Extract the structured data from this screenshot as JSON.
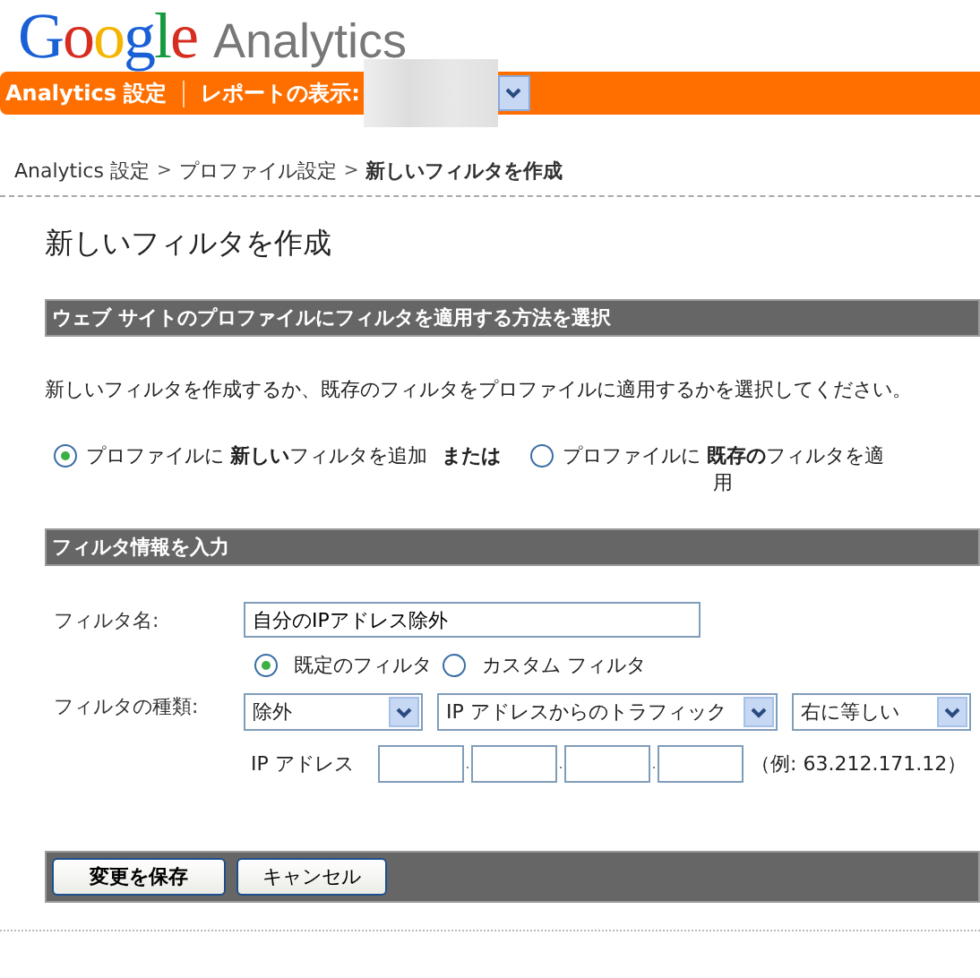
{
  "logo": {
    "brand": "Google",
    "product": "Analytics"
  },
  "nav": {
    "settings_link": "Analytics 設定",
    "report_label": "レポートの表示:"
  },
  "breadcrumb": {
    "items": [
      {
        "label": "Analytics 設定",
        "current": false
      },
      {
        "label": "プロファイル設定",
        "current": false
      },
      {
        "label": "新しいフィルタを作成",
        "current": true
      }
    ],
    "separators": [
      ">",
      ">"
    ]
  },
  "page_title": "新しいフィルタを作成",
  "method_section": {
    "header": "ウェブ サイトのプロファイルにフィルタを適用する方法を選択",
    "description": "新しいフィルタを作成するか、既存のフィルタをプロファイルに適用するかを選択してください。",
    "options": [
      {
        "label": "プロファイルに **新しい**フィルタを追加",
        "selected": true
      },
      {
        "label": "プロファイルに **既存の**フィルタを適用",
        "selected": false
      }
    ],
    "conjunction": "または"
  },
  "info_section": {
    "header": "フィルタ情報を入力",
    "name_label": "フィルタ名:",
    "name_value": "自分のIPアドレス除外",
    "type_label": "フィルタの種類:",
    "type_options": [
      {
        "label": "既定のフィルタ",
        "selected": true
      },
      {
        "label": "カスタム フィルタ",
        "selected": false
      }
    ],
    "dropdowns": [
      "除外",
      "IP アドレスからのトラフィック",
      "右に等しい"
    ],
    "ip_label": "IP アドレス",
    "ip_separators": [
      ".",
      ".",
      "."
    ],
    "ip_example": "（例: 63.212.171.12）"
  },
  "buttons": [
    {
      "label": "変更を保存",
      "kind": "primary"
    },
    {
      "label": "キャンセル",
      "kind": "secondary"
    }
  ]
}
